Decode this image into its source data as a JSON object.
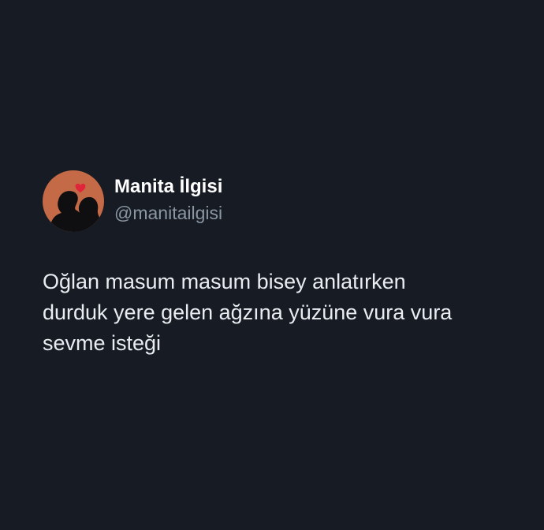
{
  "author": {
    "name": "Manita İlgisi",
    "handle": "@manitailgisi"
  },
  "tweet": {
    "text": "Oğlan masum masum bisey anlatırken\ndurduk yere gelen ağzına yüzüne vura vura\nsevme isteği"
  },
  "colors": {
    "background": "#171c24",
    "avatar_bg": "#c56a46",
    "heart": "#e0243a",
    "name": "#ffffff",
    "handle": "#8b96a3",
    "text": "#e9edf1"
  }
}
